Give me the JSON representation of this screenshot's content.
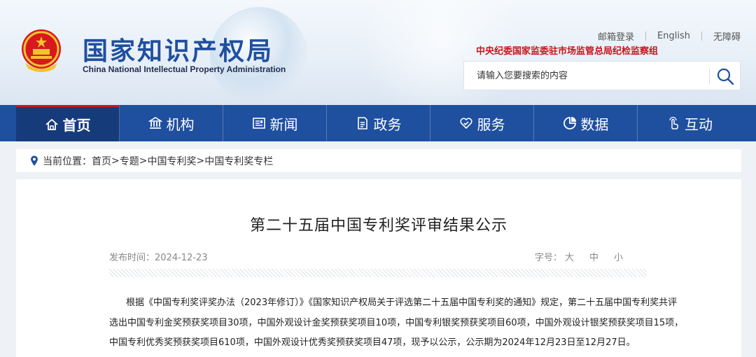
{
  "site": {
    "name_cn": "国家知识产权局",
    "name_en": "China National Intellectual Property Administration"
  },
  "toplinks": [
    "邮箱登录",
    "English",
    "无障碍"
  ],
  "supervision": "中央纪委国家监委驻市场监管总局纪检监察组",
  "search": {
    "placeholder": "请输入您要搜索的内容"
  },
  "nav": [
    {
      "label": "首页",
      "icon": "home-icon"
    },
    {
      "label": "机构",
      "icon": "institution-icon"
    },
    {
      "label": "新闻",
      "icon": "news-icon"
    },
    {
      "label": "政务",
      "icon": "government-icon"
    },
    {
      "label": "服务",
      "icon": "service-icon"
    },
    {
      "label": "数据",
      "icon": "data-pie-icon"
    },
    {
      "label": "互动",
      "icon": "interaction-icon"
    }
  ],
  "breadcrumb": {
    "prefix": "当前位置：",
    "items": [
      "首页",
      "专题",
      "中国专利奖",
      "中国专利奖专栏"
    ],
    "separator": ">"
  },
  "article": {
    "title": "第二十五届中国专利奖评审结果公示",
    "published": "发布时间：2024-12-23",
    "font_size_label": "字号：",
    "font_sizes": [
      "大",
      "中",
      "小"
    ],
    "paragraph_lines": [
      "根据《中国专利奖评奖办法（2023年修订）》《国家知识产权局关于评选第二十五届中国专利奖的通知》规定，第二十五届中国专利奖共评",
      "选出中国专利金奖预获奖项目30项，中国外观设计金奖预获奖项目10项，中国专利银奖预获奖项目60项，中国外观设计银奖预获奖项目15项，",
      "中国专利优秀奖预获奖项目610项，中国外观设计优秀奖预获奖项目47项，现予以公示，公示期为2024年12月23日至12月27日。"
    ]
  },
  "colors": {
    "brand_blue": "#1f4f9f",
    "accent_red": "#c8161d"
  }
}
